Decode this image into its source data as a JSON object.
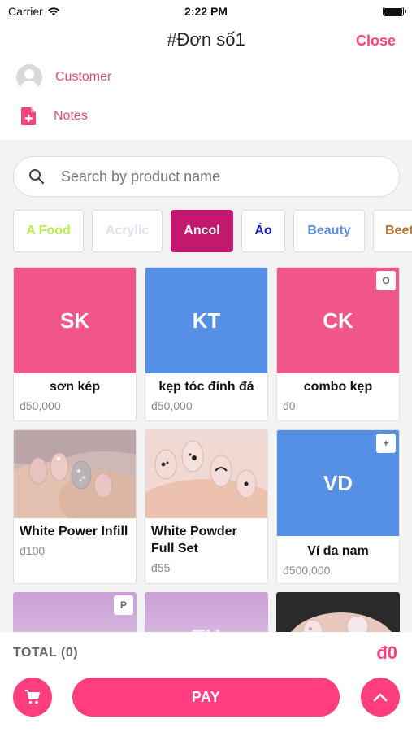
{
  "status_bar": {
    "carrier": "Carrier",
    "time": "2:22 PM"
  },
  "header": {
    "title": "#Đơn số1",
    "close_label": "Close"
  },
  "customer": {
    "label": "Customer"
  },
  "notes": {
    "label": "Notes"
  },
  "search": {
    "placeholder": "Search by product name",
    "value": ""
  },
  "categories": [
    {
      "label": "A Food",
      "color": "#b8f04a",
      "active": false
    },
    {
      "label": "Acrylic",
      "color": "#e4e4f2",
      "active": false
    },
    {
      "label": "Ancol",
      "color": "#ffffff",
      "active": true
    },
    {
      "label": "Áo",
      "color": "#1a23c4",
      "active": false
    },
    {
      "label": "Beauty",
      "color": "#5b8fe6",
      "active": false
    },
    {
      "label": "Beet",
      "color": "#b8753a",
      "active": false
    }
  ],
  "products": [
    {
      "initials": "SK",
      "name": "sơn kép",
      "price": "đ50,000",
      "bg": "#f0568a",
      "badge": ""
    },
    {
      "initials": "KT",
      "name": "kẹp tóc đính đá",
      "price": "đ50,000",
      "bg": "#5590e6",
      "badge": ""
    },
    {
      "initials": "CK",
      "name": "combo kẹp",
      "price": "đ0",
      "bg": "#f0568a",
      "badge": "O"
    },
    {
      "initials": "",
      "name": "White Power Infill",
      "price": "đ100",
      "bg": "",
      "badge": ""
    },
    {
      "initials": "",
      "name": "White Powder Full Set",
      "price": "đ55",
      "bg": "",
      "badge": ""
    },
    {
      "initials": "VD",
      "name": "Ví da nam",
      "price": "đ500,000",
      "bg": "#5590e6",
      "badge": "+"
    },
    {
      "initials": "",
      "name": "",
      "price": "",
      "bg": "#c9a0d6",
      "badge": "P"
    },
    {
      "initials": "TH",
      "name": "",
      "price": "",
      "bg": "#c9a0d6",
      "badge": ""
    },
    {
      "initials": "",
      "name": "",
      "price": "",
      "bg": "",
      "badge": ""
    }
  ],
  "footer": {
    "total_label": "TOTAL (0)",
    "total_value": "đ0",
    "pay_label": "PAY"
  },
  "colors": {
    "accent": "#ff3d7f",
    "active_chip": "#c2186e"
  }
}
